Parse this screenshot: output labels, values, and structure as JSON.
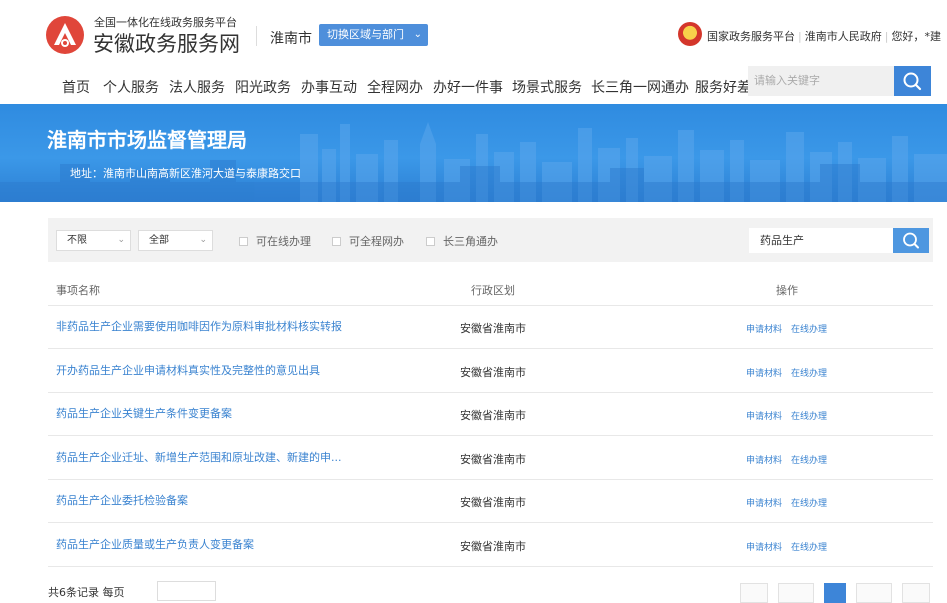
{
  "header": {
    "platform_subtitle": "全国一体化在线政务服务平台",
    "platform_title": "安徽政务服务网",
    "region": "淮南市",
    "switch_label": "切换区域与部门",
    "links": [
      "国家政务服务平台",
      "淮南市人民政府",
      "您好，",
      "*建"
    ]
  },
  "nav": {
    "items": [
      "首页",
      "个人服务",
      "法人服务",
      "阳光政务",
      "办事互动",
      "全程网办",
      "办好一件事",
      "场景式服务",
      "长三角一网通办",
      "服务好差"
    ],
    "search_placeholder": "请输入关键字"
  },
  "banner": {
    "title": "淮南市市场监督管理局",
    "address": "地址：淮南市山南高新区淮河大道与泰康路交口"
  },
  "filters": {
    "select1": "不限",
    "select2": "全部",
    "checkboxes": [
      "可在线办理",
      "可全程网办",
      "长三角通办"
    ],
    "keyword": "药品生产"
  },
  "table": {
    "headers": [
      "事项名称",
      "行政区划",
      "操作"
    ],
    "rows": [
      {
        "name": "非药品生产企业需要使用咖啡因作为原料审批材料核实转报",
        "region": "安徽省淮南市",
        "op1": "申请材料",
        "op2": "在线办理"
      },
      {
        "name": "开办药品生产企业申请材料真实性及完整性的意见出具",
        "region": "安徽省淮南市",
        "op1": "申请材料",
        "op2": "在线办理"
      },
      {
        "name": "药品生产企业关键生产条件变更备案",
        "region": "安徽省淮南市",
        "op1": "申请材料",
        "op2": "在线办理"
      },
      {
        "name": "药品生产企业迁址、新增生产范围和原址改建、新建的申...",
        "region": "安徽省淮南市",
        "op1": "申请材料",
        "op2": "在线办理"
      },
      {
        "name": "药品生产企业委托检验备案",
        "region": "安徽省淮南市",
        "op1": "申请材料",
        "op2": "在线办理"
      },
      {
        "name": "药品生产企业质量或生产负责人变更备案",
        "region": "安徽省淮南市",
        "op1": "申请材料",
        "op2": "在线办理"
      }
    ]
  },
  "pagination": {
    "summary": "共6条记录 每页"
  },
  "colors": {
    "brand_red": "#e0463a",
    "primary_blue": "#3d85d8",
    "link_blue": "#3a83d0",
    "banner_blue": "#3b98e8"
  }
}
